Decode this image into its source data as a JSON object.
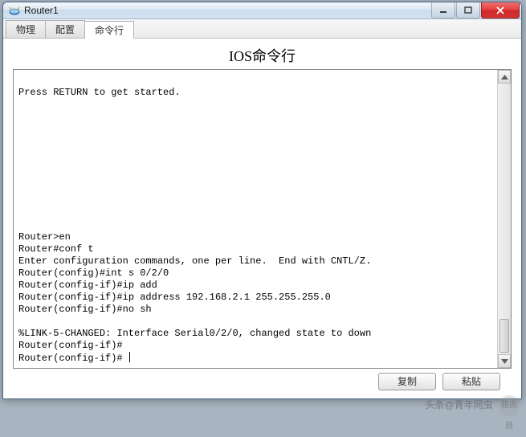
{
  "window": {
    "title": "Router1"
  },
  "tabs": {
    "t0": "物理",
    "t1": "配置",
    "t2": "命令行"
  },
  "heading": "IOS命令行",
  "terminal": {
    "line0": "Press RETURN to get started.",
    "blank": "",
    "line1": "Router>en",
    "line2": "Router#conf t",
    "line3": "Enter configuration commands, one per line.  End with CNTL/Z.",
    "line4": "Router(config)#int s 0/2/0",
    "line5": "Router(config-if)#ip add",
    "line6": "Router(config-if)#ip address 192.168.2.1 255.255.255.0",
    "line7": "Router(config-if)#no sh",
    "line8": "%LINK-5-CHANGED: Interface Serial0/2/0, changed state to down",
    "line9": "Router(config-if)#",
    "line10": "Router(config-if)# "
  },
  "buttons": {
    "copy": "复制",
    "paste": "粘贴"
  },
  "watermark": {
    "text": "头条@青年网虫"
  }
}
